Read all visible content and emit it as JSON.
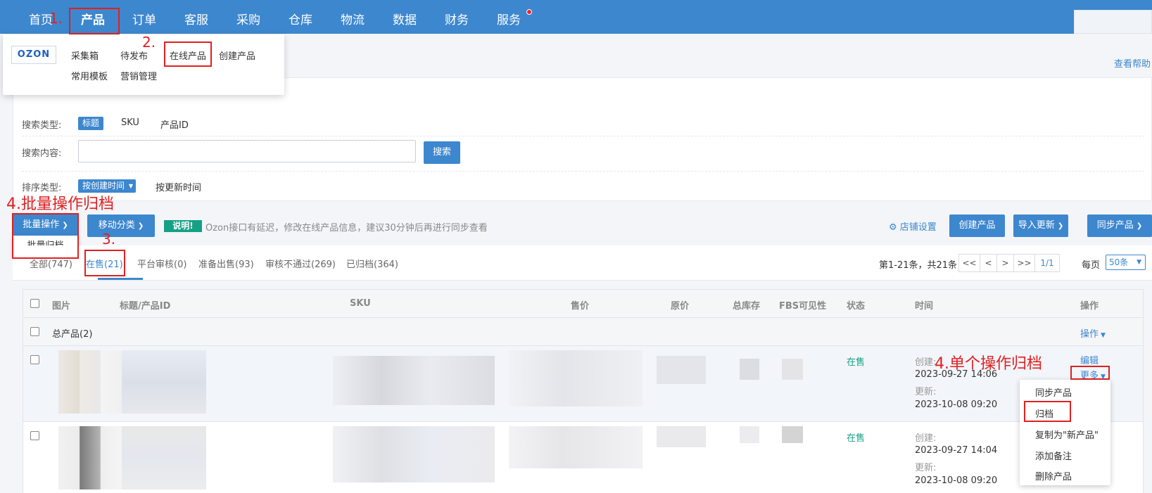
{
  "nav": {
    "items": [
      "首页",
      "产品",
      "订单",
      "客服",
      "采购",
      "仓库",
      "物流",
      "数据",
      "财务",
      "服务"
    ]
  },
  "annotations": {
    "step1": "1.",
    "step2": "2.",
    "step3": "3.",
    "step4_batch": "4.批量操作归档",
    "step4_single": "4.单个操作归档"
  },
  "product_menu": {
    "logo": "OZON",
    "links": [
      "采集箱",
      "待发布",
      "在线产品",
      "创建产品",
      "常用模板",
      "营销管理"
    ]
  },
  "help_link": "查看帮助",
  "filters": {
    "search_type_label": "搜索类型:",
    "search_types": [
      "标题",
      "SKU",
      "产品ID"
    ],
    "search_content_label": "搜索内容:",
    "search_value": "",
    "search_button": "搜索",
    "sort_label": "排序类型:",
    "sort_active": "按创建时间",
    "sort_other": "按更新时间"
  },
  "toolbar": {
    "batch_ops": "批量操作",
    "batch_menu_item": "批量归档",
    "move_category": "移动分类",
    "note_badge": "说明!",
    "note_text": "Ozon接口有延迟，修改在线产品信息，建议30分钟后再进行同步查看",
    "shop_settings": "店铺设置",
    "create_product": "创建产品",
    "import_update": "导入更新",
    "sync_product": "同步产品"
  },
  "tabs": [
    "全部(747)",
    "在售(21)",
    "平台审核(0)",
    "准备出售(93)",
    "审核不通过(269)",
    "已归档(364)"
  ],
  "pagination": {
    "info": "第1-21条，共21条",
    "first": "<<",
    "prev": "<",
    "next": ">",
    "last": ">>",
    "page": "1/1",
    "per_page_label": "每页",
    "per_page_value": "50条"
  },
  "table": {
    "headers": [
      "图片",
      "标题/产品ID",
      "SKU",
      "售价",
      "原价",
      "总库存",
      "FBS可见性",
      "状态",
      "时间",
      "操作"
    ],
    "group_label": "总产品(2)",
    "group_action": "操作",
    "rows": [
      {
        "status": "在售",
        "created_label": "创建:",
        "created": "2023-09-27 14:06",
        "updated_label": "更新:",
        "updated": "2023-10-08 09:20",
        "edit": "编辑",
        "more": "更多"
      },
      {
        "status": "在售",
        "created_label": "创建:",
        "created": "2023-09-27 14:04",
        "updated_label": "更新:",
        "updated": "2023-10-08 09:20"
      }
    ]
  },
  "more_menu": [
    "同步产品",
    "归档",
    "复制为\"新产品\"",
    "添加备注",
    "删除产品"
  ],
  "colors": {
    "primary": "#3d87ce",
    "annotation": "#e02020",
    "status_green": "#16a085"
  }
}
